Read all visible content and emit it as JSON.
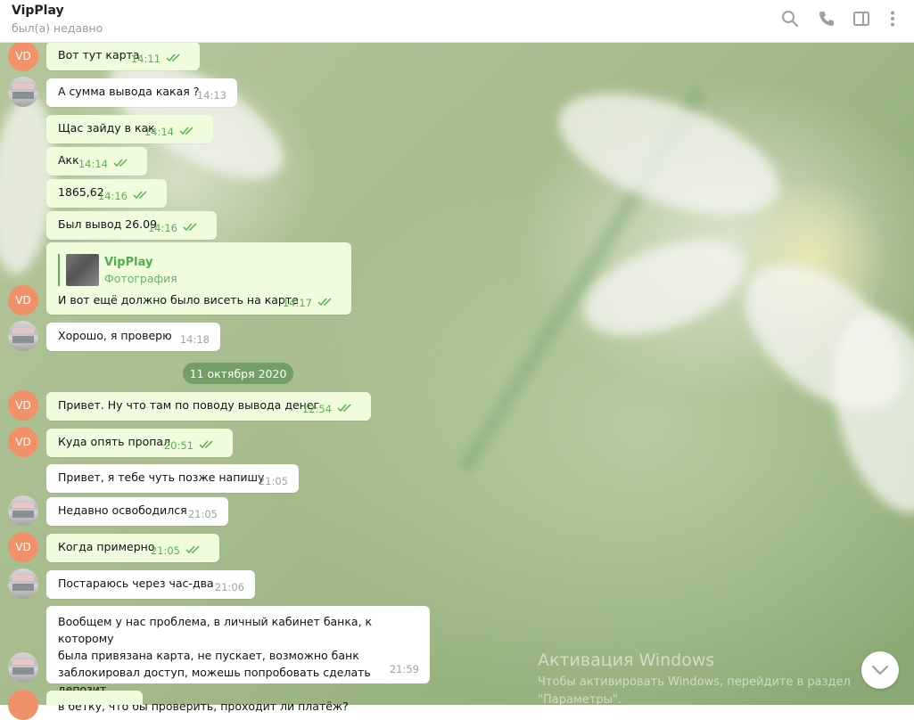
{
  "header": {
    "title": "VipPlay",
    "status": "был(а) недавно",
    "icons": [
      "search-icon",
      "phone-icon",
      "sidebar-icon",
      "more-icon"
    ]
  },
  "avatar_initials": "VD",
  "date_divider": "11 октября 2020",
  "messages": [
    {
      "text": "Вот тут карта",
      "time": "14:11"
    },
    {
      "text": "А сумма вывода какая ?",
      "time": "14:13"
    },
    {
      "text": "Щас зайду в как",
      "time": "14:14"
    },
    {
      "text": "Акк",
      "time": "14:14"
    },
    {
      "text": "1865,62",
      "time": "14:16"
    },
    {
      "text": "Был вывод 26.09",
      "time": "14:16"
    },
    {
      "reply_name": "VipPlay",
      "reply_type": "Фотография",
      "text": "И вот ещё должно было висеть на карте",
      "time": "14:17"
    },
    {
      "text": "Хорошо,  я проверю",
      "time": "14:18"
    },
    {
      "text": "Привет. Ну что там по поводу вывода денег",
      "time": "12:54"
    },
    {
      "text": "Куда опять пропал",
      "time": "20:51"
    },
    {
      "text": "Привет, я тебе чуть позже напишу",
      "time": "21:05"
    },
    {
      "text": "Недавно освободился",
      "time": "21:05"
    },
    {
      "text": "Когда примерно",
      "time": "21:05"
    },
    {
      "text": "Постараюсь через  час-два",
      "time": "21:06"
    },
    {
      "lines": [
        "Вообщем у нас проблема,  в личный кабинет  банка, к которому",
        "была  привязана карта, не пускает, возможно банк",
        "заблокировал  доступ, можешь  попробовать  сделать депозит",
        "в бетку, что бы проверить,  проходит ли платёж?"
      ],
      "time": "21:59"
    }
  ],
  "watermark": {
    "title": "Активация Windows",
    "line1": "Чтобы активировать Windows, перейдите в раздел",
    "line2": "\"Параметры\"."
  },
  "colors": {
    "outgoing_bubble": "#effdde",
    "incoming_bubble": "#ffffff",
    "accent_green": "#5fae55",
    "avatar_vd": "#f0916a"
  }
}
